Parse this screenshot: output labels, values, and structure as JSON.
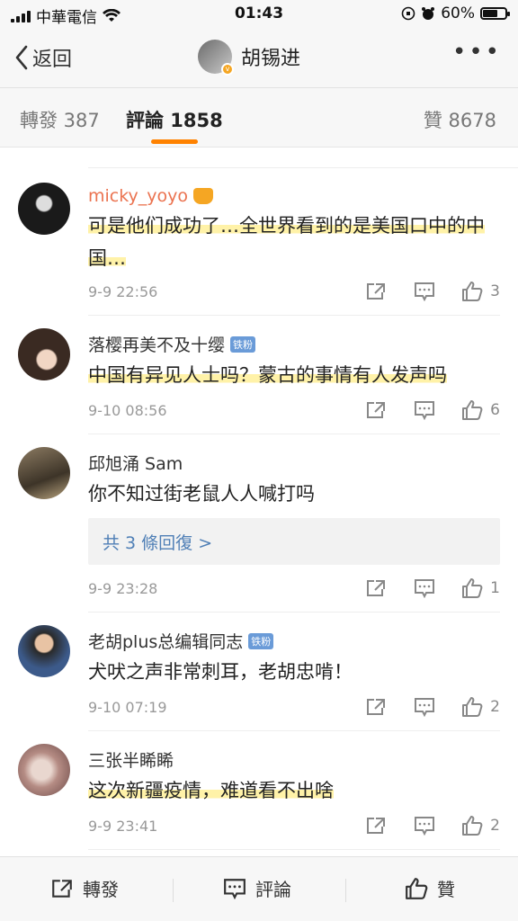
{
  "status": {
    "carrier": "中華電信",
    "time": "01:43",
    "battery": "60%"
  },
  "nav": {
    "back_label": "返回",
    "title": "胡锡进"
  },
  "tabs": [
    {
      "label": "轉發 387"
    },
    {
      "label": "評論 1858"
    },
    {
      "label": "贊 8678"
    }
  ],
  "comments": [
    {
      "name": "micky_yoyo",
      "text": "可是他们成功了…全世界看到的是美国口中的中国…",
      "time": "9-9 22:56",
      "likes": "3"
    },
    {
      "name": "落樱再美不及十缨",
      "badge": "铁粉",
      "text": "中国有异见人士吗？蒙古的事情有人发声吗",
      "time": "9-10 08:56",
      "likes": "6"
    },
    {
      "name": "邱旭涌 Sam",
      "text": "你不知过街老鼠人人喊打吗",
      "replies": "共 3 條回復 >",
      "time": "9-9 23:28",
      "likes": "1"
    },
    {
      "name": "老胡plus总编辑同志",
      "badge": "铁粉",
      "text": "犬吠之声非常刺耳，老胡忠啃！",
      "time": "9-10 07:19",
      "likes": "2"
    },
    {
      "name": "三张半睎睎",
      "text": "这次新疆疫情，难道看不出啥",
      "time": "9-9 23:41",
      "likes": "2"
    }
  ],
  "bottom": {
    "repost": "轉發",
    "comment": "評論",
    "like": "贊"
  },
  "colors": {
    "accent": "#ff8200",
    "link": "#4f7fb6",
    "vip_name": "#eb7350",
    "highlight": "#fff2a8"
  }
}
